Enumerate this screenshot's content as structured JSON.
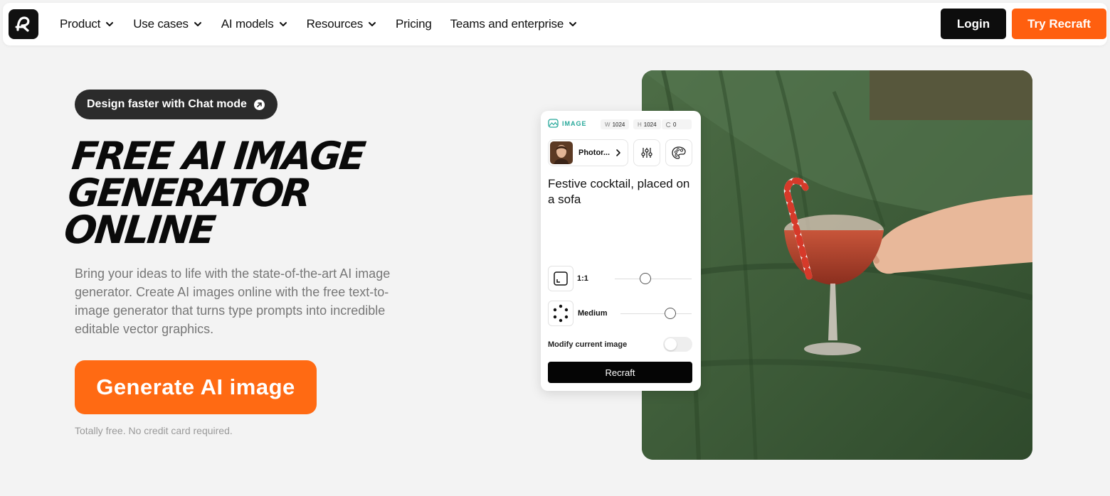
{
  "nav": {
    "items": [
      {
        "label": "Product",
        "dropdown": true
      },
      {
        "label": "Use cases",
        "dropdown": true
      },
      {
        "label": "AI models",
        "dropdown": true
      },
      {
        "label": "Resources",
        "dropdown": true
      },
      {
        "label": "Pricing",
        "dropdown": false
      },
      {
        "label": "Teams and enterprise",
        "dropdown": true
      }
    ],
    "login_label": "Login",
    "try_label": "Try Recraft"
  },
  "hero": {
    "pill_label": "Design faster with Chat mode",
    "headline_lines": [
      "FREE AI IMAGE",
      "GENERATOR",
      "ONLINE"
    ],
    "description": "Bring your ideas to life with the state-of-the-art AI image generator. Create AI images online with the free text-to-image generator that turns type prompts into incredible editable vector graphics.",
    "cta_label": "Generate AI image",
    "note": "Totally free. No credit card required."
  },
  "panel": {
    "mode_label": "IMAGE",
    "width_key": "W",
    "width_value": "1024",
    "height_key": "H",
    "height_value": "1024",
    "count_value": "0",
    "style_label": "Photor...",
    "prompt": "Festive cocktail, placed on a sofa",
    "ratio_label": "1:1",
    "ratio_level": 0.4,
    "detail_label": "Medium",
    "detail_level": 0.7,
    "modify_label": "Modify current image",
    "modify_on": false,
    "button_label": "Recraft"
  },
  "colors": {
    "accent": "#ff5f0f",
    "cta": "#ff6a13",
    "dark": "#0d0d0d",
    "teal": "#27a89a",
    "background": "#f3f3f3"
  }
}
